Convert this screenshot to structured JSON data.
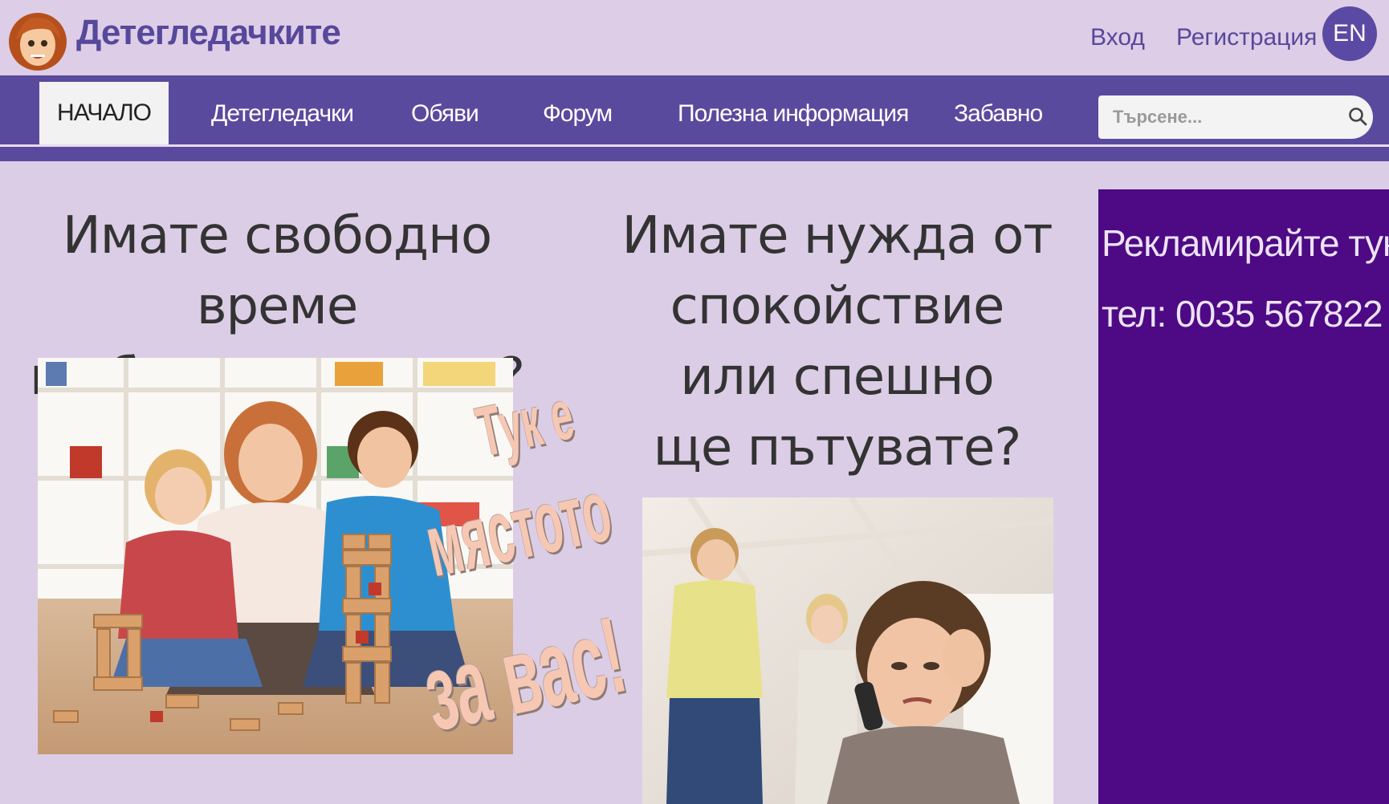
{
  "header": {
    "site_name": "Детегледачките",
    "login_label": "Вход",
    "register_label": "Регистрация",
    "language_label": "EN"
  },
  "nav": {
    "items": [
      {
        "label": "НАЧАЛО",
        "active": true
      },
      {
        "label": "Детегледачки"
      },
      {
        "label": "Обяви"
      },
      {
        "label": "Форум"
      },
      {
        "label": "Полезна информация"
      },
      {
        "label": "Забавно"
      }
    ],
    "search_placeholder": "Търсене..."
  },
  "main": {
    "headline_left": [
      "Имате свободно време",
      "и  обичате децата?"
    ],
    "headline_right": [
      "Имате нужда от",
      "спокойствие",
      "или спешно",
      "ще пътувате?"
    ],
    "overlay": [
      "Тук е",
      "мястото",
      "за вас!"
    ]
  },
  "ad": {
    "line1": "Рекламирайте тук!",
    "line2": "тел: 0035 567822"
  },
  "colors": {
    "page_bg": "#dccde6",
    "nav_bg": "#5a4a9e",
    "brand": "#56489a",
    "ad_bg": "#4d0a84"
  }
}
